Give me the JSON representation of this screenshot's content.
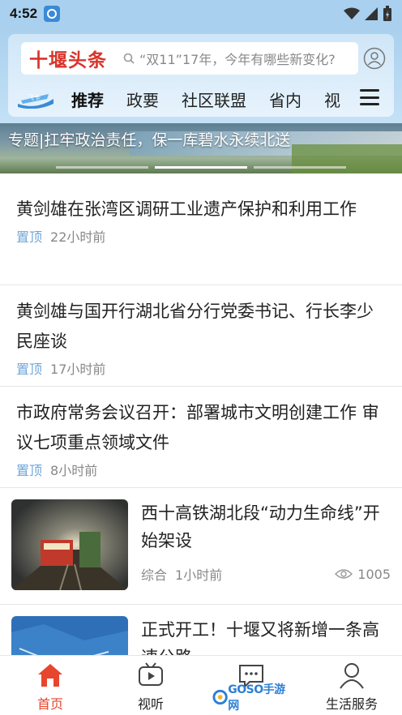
{
  "status_bar": {
    "time": "4:52"
  },
  "header": {
    "logo_text": "十堰头条",
    "search_placeholder": "“双11”17年，今年有哪些新变化?",
    "nav_logo_text": "飞卡",
    "tabs": [
      "推荐",
      "政要",
      "社区联盟",
      "省内",
      "视"
    ],
    "active_tab": "推荐"
  },
  "banner": {
    "title": "专题|扛牢政治责任，保一库碧水永续北送"
  },
  "articles": [
    {
      "title": "黄剑雄在张湾区调研工业遗产保护和利用工作",
      "tag": "置顶",
      "time": "22小时前"
    },
    {
      "title": "黄剑雄与国开行湖北省分行党委书记、行长李少民座谈",
      "tag": "置顶",
      "time": "17小时前"
    },
    {
      "title": "市政府常务会议召开：部署城市文明创建工作 审议七项重点领域文件",
      "tag": "置顶",
      "time": "8小时前"
    }
  ],
  "image_articles": [
    {
      "title": "西十高铁湖北段“动力生命线”开始架设",
      "category": "综合",
      "time": "1小时前",
      "views": "1005"
    },
    {
      "title": "正式开工！十堰又将新增一条高速公路",
      "category": "",
      "time": "",
      "views": ""
    }
  ],
  "tabbar": {
    "items": [
      "首页",
      "视听",
      "",
      "生活服务"
    ],
    "active": "首页"
  },
  "watermark": {
    "text": "GOSO手游网"
  },
  "colors": {
    "accent": "#e8452f",
    "header_bg": "#a9d0ee",
    "pin_tag": "#6fa6d8",
    "logo_red": "#d9342b"
  }
}
